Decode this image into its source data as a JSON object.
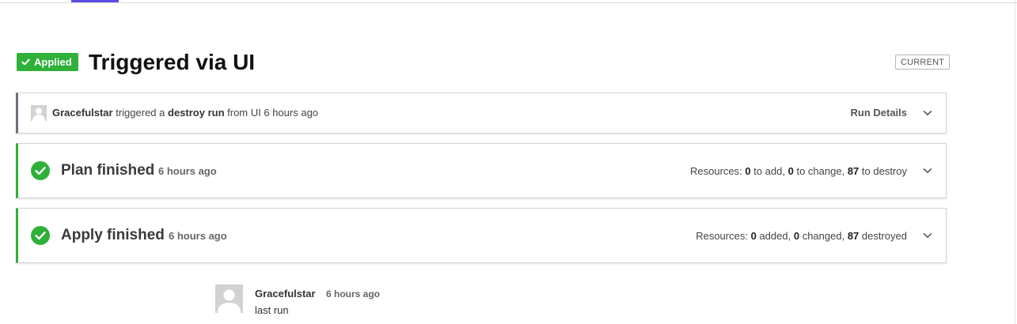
{
  "header": {
    "status_badge": "Applied",
    "title": "Triggered via UI",
    "current_tag": "CURRENT",
    "accent_color": "#5c4ee5",
    "success_color": "#2eb039"
  },
  "trigger": {
    "user": "Gracefulstar",
    "text_triggered": "triggered a",
    "run_type": "destroy run",
    "text_from": "from UI 6 hours ago",
    "details_label": "Run Details"
  },
  "plan": {
    "title": "Plan finished",
    "time": "6 hours ago",
    "resources_label": "Resources:",
    "add_count": "0",
    "add_label": "to add,",
    "change_count": "0",
    "change_label": "to change,",
    "destroy_count": "87",
    "destroy_label": "to destroy"
  },
  "apply": {
    "title": "Apply finished",
    "time": "6 hours ago",
    "resources_label": "Resources:",
    "added_count": "0",
    "added_label": "added,",
    "changed_count": "0",
    "changed_label": "changed,",
    "destroyed_count": "87",
    "destroyed_label": "destroyed"
  },
  "comment": {
    "author": "Gracefulstar",
    "time": "6 hours ago",
    "body": "last run"
  }
}
